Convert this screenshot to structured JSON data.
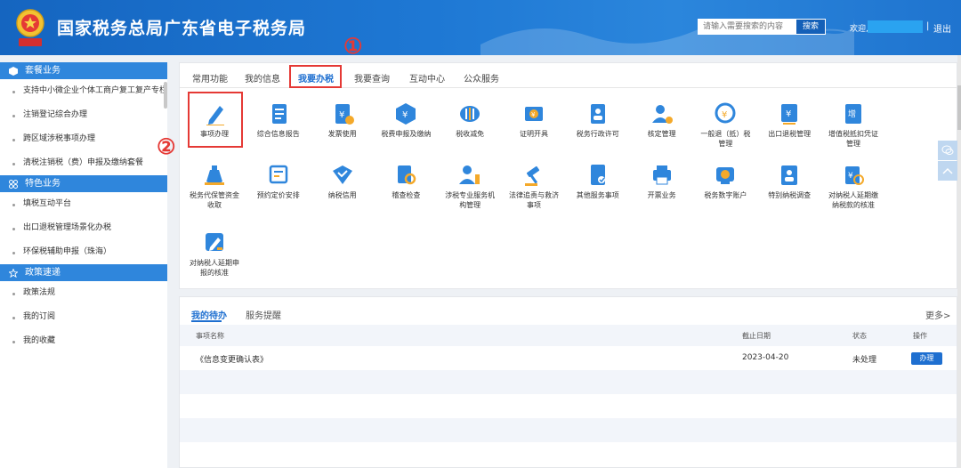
{
  "header": {
    "title": "国家税务总局广东省电子税务局",
    "search_placeholder": "请输入需要搜索的内容",
    "search_button": "搜索",
    "welcome": "欢迎,",
    "separator": "|",
    "logout": "退出"
  },
  "sidebar": {
    "sections": [
      {
        "title": "套餐业务",
        "items": [
          "支持中小微企业个体工商户复工复产专栏",
          "注销登记综合办理",
          "跨区域涉税事项办理",
          "清税注销税（费）申报及缴纳套餐"
        ]
      },
      {
        "title": "特色业务",
        "items": [
          "填税互动平台",
          "出口退税管理场景化办税",
          "环保税辅助申报（珠海）"
        ]
      },
      {
        "title": "政策速递",
        "items": [
          "政策法规",
          "我的订阅",
          "我的收藏"
        ]
      }
    ]
  },
  "tabs": [
    {
      "label": "常用功能",
      "active": false
    },
    {
      "label": "我的信息",
      "active": false
    },
    {
      "label": "我要办税",
      "active": true
    },
    {
      "label": "我要查询",
      "active": false
    },
    {
      "label": "互动中心",
      "active": false
    },
    {
      "label": "公众服务",
      "active": false
    }
  ],
  "annotations": {
    "one": "①",
    "two": "②"
  },
  "grid": [
    {
      "l1": "事项办理",
      "l2": "",
      "icon": "pencil-icon"
    },
    {
      "l1": "综合信息报告",
      "l2": "",
      "icon": "document-icon"
    },
    {
      "l1": "发票使用",
      "l2": "",
      "icon": "invoice-icon"
    },
    {
      "l1": "税费申报及缴纳",
      "l2": "",
      "icon": "tax-declare-icon"
    },
    {
      "l1": "税收减免",
      "l2": "",
      "icon": "coin-stack-icon"
    },
    {
      "l1": "证明开具",
      "l2": "",
      "icon": "certificate-icon"
    },
    {
      "l1": "税务行政许可",
      "l2": "",
      "icon": "permit-icon"
    },
    {
      "l1": "核定管理",
      "l2": "",
      "icon": "user-gear-icon"
    },
    {
      "l1": "一般退（抵）税",
      "l2": "管理",
      "icon": "refund-cycle-icon"
    },
    {
      "l1": "出口退税管理",
      "l2": "",
      "icon": "export-refund-icon"
    },
    {
      "l1": "增值税抵扣凭证",
      "l2": "管理",
      "icon": "vat-voucher-icon"
    },
    {
      "l1": "税务代保管资金",
      "l2": "收取",
      "icon": "money-bag-icon"
    },
    {
      "l1": "预约定价安排",
      "l2": "",
      "icon": "pricing-icon"
    },
    {
      "l1": "纳税信用",
      "l2": "",
      "icon": "credit-icon"
    },
    {
      "l1": "稽查检查",
      "l2": "",
      "icon": "inspection-icon"
    },
    {
      "l1": "涉税专业服务机",
      "l2": "构管理",
      "icon": "agency-icon"
    },
    {
      "l1": "法律追责与救济",
      "l2": "事项",
      "icon": "gavel-icon"
    },
    {
      "l1": "其他服务事项",
      "l2": "",
      "icon": "other-service-icon"
    },
    {
      "l1": "开票业务",
      "l2": "",
      "icon": "printer-icon"
    },
    {
      "l1": "税务数字账户",
      "l2": "",
      "icon": "digital-account-icon"
    },
    {
      "l1": "特别纳税调查",
      "l2": "",
      "icon": "special-investigation-icon"
    },
    {
      "l1": "对纳税人延期缴",
      "l2": "纳税款的核准",
      "icon": "delay-payment-icon"
    },
    {
      "l1": "对纳税人延期申",
      "l2": "报的核准",
      "icon": "delay-declare-icon"
    }
  ],
  "todo": {
    "tabs": [
      "我的待办",
      "服务提醒"
    ],
    "more": "更多>",
    "columns": [
      "事项名称",
      "截止日期",
      "状态",
      "操作"
    ],
    "rows": [
      {
        "name": "《信息变更确认表》",
        "date": "2023-04-20",
        "status": "未处理",
        "action": "办理"
      }
    ]
  },
  "colors": {
    "header_blue": "#1e78d4",
    "accent_red": "#e53935",
    "link_blue": "#1e6fd0"
  }
}
